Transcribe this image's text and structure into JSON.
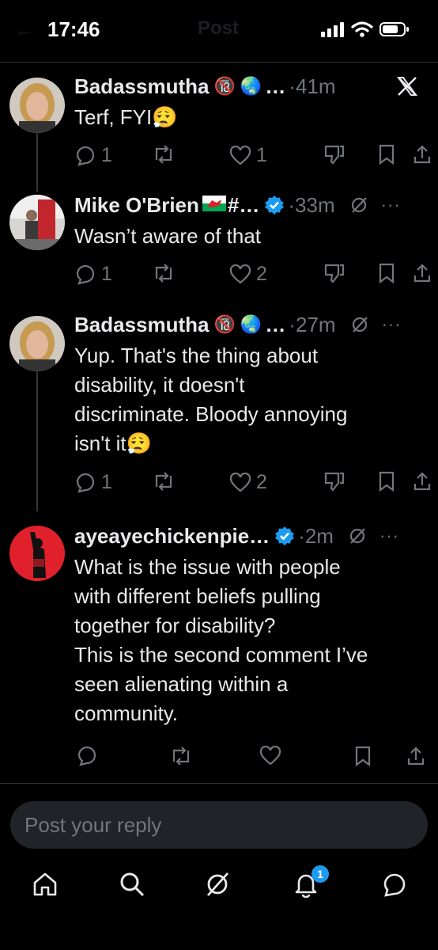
{
  "status_bar": {
    "time": "17:46",
    "faded_title": "Post",
    "faded_back": "←"
  },
  "posts": [
    {
      "author": "Badassmutha",
      "emoji": [
        "🔞",
        "🌏"
      ],
      "ellipsis": "…",
      "time": "41m",
      "text": [
        "Terf, FYI"
      ],
      "trailing_emoji": "😮‍💨",
      "replies": "1",
      "retweets": "",
      "likes": "1",
      "verified": false,
      "top_right": "x-logo-icon"
    },
    {
      "author": "Mike O'Brien",
      "emoji": [
        "🏴"
      ],
      "ellipsis": "#…",
      "time": "33m",
      "text": [
        "Wasn’t aware of that"
      ],
      "trailing_emoji": "",
      "replies": "1",
      "retweets": "",
      "likes": "2",
      "verified": true
    },
    {
      "author": "Badassmutha",
      "emoji": [
        "🔞",
        "🌏"
      ],
      "ellipsis": "…",
      "time": "27m",
      "text": [
        "Yup. That's the thing about",
        "disability, it doesn't",
        "discriminate. Bloody annoying",
        "isn't it"
      ],
      "trailing_emoji": "😮‍💨",
      "replies": "1",
      "retweets": "",
      "likes": "2",
      "verified": false
    },
    {
      "author": "ayeayechickenpie…",
      "emoji": [],
      "ellipsis": "",
      "time": "2m",
      "text": [
        "What is the issue with people",
        "with different beliefs pulling",
        "together for disability?",
        "This is the second comment I’ve",
        "seen alienating within a",
        "community."
      ],
      "trailing_emoji": "",
      "replies": "",
      "retweets": "",
      "likes": "",
      "verified": true
    }
  ],
  "meta_dot": "·",
  "more_dots": "···",
  "reply_placeholder": "Post your reply",
  "notification_count": "1",
  "colors": {
    "background": "#000000",
    "text": "#e7e9ea",
    "muted": "#71767b",
    "verified": "#1d9bf0",
    "divider": "#2f3336",
    "input_bg": "#202327"
  }
}
